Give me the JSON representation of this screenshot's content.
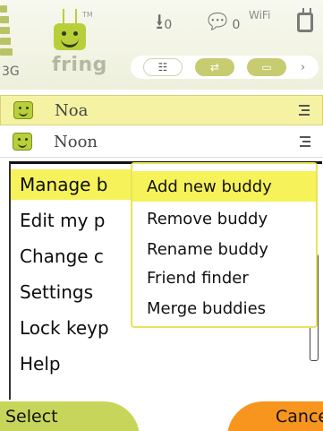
{
  "status": {
    "network": "3G",
    "upload_count": "0",
    "chat_count": "0",
    "wifi": "WiFi"
  },
  "app": {
    "name": "fring",
    "tm": "TM"
  },
  "tabs": [
    {
      "icon": "contacts-tab-icon",
      "glyph": "☷",
      "active": true
    },
    {
      "icon": "transfer-tab-icon",
      "glyph": "⇄",
      "active": false
    },
    {
      "icon": "window-tab-icon",
      "glyph": "▭",
      "active": false
    }
  ],
  "buddies": [
    {
      "name": "Noa",
      "selected": true
    },
    {
      "name": "Noon",
      "selected": false
    }
  ],
  "options_menu": {
    "items": [
      {
        "label": "Manage b",
        "highlighted": true
      },
      {
        "label": "Edit my p",
        "highlighted": false
      },
      {
        "label": "Change c",
        "highlighted": false
      },
      {
        "label": "Settings",
        "highlighted": false
      },
      {
        "label": "Lock keyp",
        "highlighted": false
      },
      {
        "label": "Help",
        "highlighted": false
      }
    ]
  },
  "submenu": {
    "items": [
      {
        "label": "Add new buddy",
        "highlighted": true
      },
      {
        "label": "Remove buddy",
        "highlighted": false
      },
      {
        "label": "Rename buddy",
        "highlighted": false
      },
      {
        "label": "Friend finder",
        "highlighted": false
      },
      {
        "label": "Merge buddies",
        "highlighted": false
      }
    ]
  },
  "softkeys": {
    "left": "Select",
    "right": "Cance"
  },
  "colors": {
    "highlight": "#f6f25a",
    "selected_row": "#f5f3a3",
    "brand_green": "#b9cf3a",
    "softkey_right": "#f7951f",
    "softkey_left": "#c7d65a"
  }
}
